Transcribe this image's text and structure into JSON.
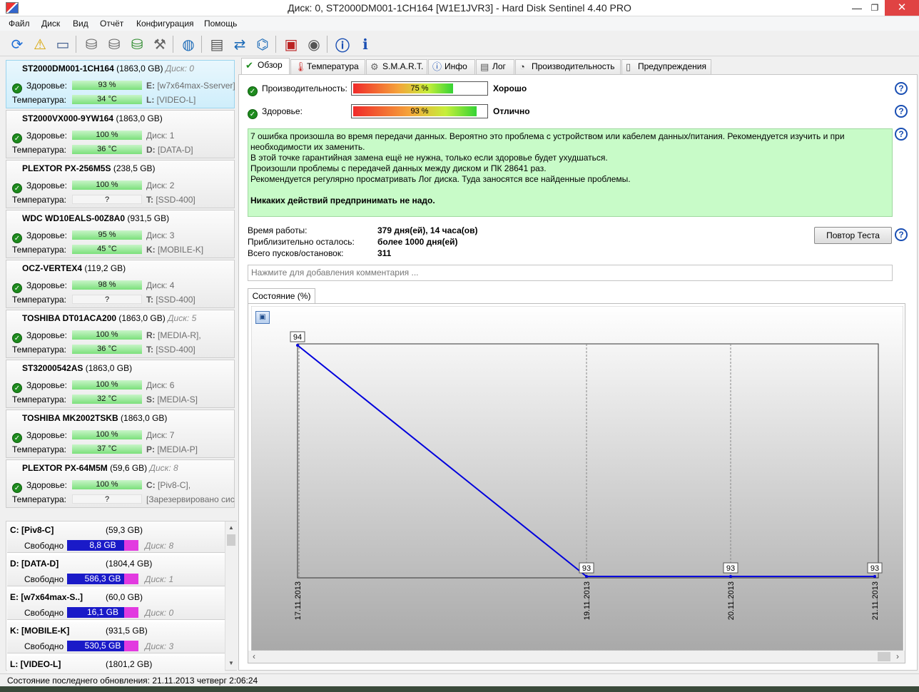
{
  "window": {
    "title": "Диск: 0, ST2000DM001-1CH164 [W1E1JVR3]  -  Hard Disk Sentinel 4.40 PRO",
    "min": "—",
    "max": "❐",
    "close": "✕"
  },
  "menu": [
    "Файл",
    "Диск",
    "Вид",
    "Отчёт",
    "Конфигурация",
    "Помощь"
  ],
  "toolbar_icons": [
    "refresh-icon",
    "alert-icon",
    "disk-icon",
    "surface-test-icon",
    "disk-check-icon",
    "disk-ok-icon",
    "disk-tools-icon",
    "globe-icon",
    "report-icon",
    "transfer-icon",
    "network-icon",
    "settings-icon",
    "sound-icon",
    "help-icon",
    "about-icon"
  ],
  "disks": [
    {
      "name": "ST2000DM001-1CH164",
      "size": "(1863,0 GB)",
      "disk": "Диск: 0",
      "health_label": "Здоровье:",
      "health": "93 %",
      "health_value": 93,
      "temp_label": "Температура:",
      "temp": "34 °C",
      "drive1_letter": "E:",
      "drive1": "[w7x64max-Sserver],",
      "drive2_letter": "L:",
      "drive2": "[VIDEO-L]",
      "selected": true
    },
    {
      "name": "ST2000VX000-9YW164",
      "size": "(1863,0 GB)",
      "disk": "",
      "health_label": "Здоровье:",
      "health": "100 %",
      "health_value": 100,
      "temp_label": "Температура:",
      "temp": "36 °C",
      "drive1_letter": "",
      "drive1": "Диск: 1",
      "drive2_letter": "D:",
      "drive2": "[DATA-D]"
    },
    {
      "name": "PLEXTOR PX-256M5S",
      "size": "(238,5 GB)",
      "disk": "",
      "health_label": "Здоровье:",
      "health": "100 %",
      "health_value": 100,
      "temp_label": "Температура:",
      "temp": "?",
      "drive1_letter": "",
      "drive1": "Диск: 2",
      "drive2_letter": "T:",
      "drive2": "[SSD-400]"
    },
    {
      "name": "WDC WD10EALS-00Z8A0",
      "size": "(931,5 GB)",
      "disk": "",
      "health_label": "Здоровье:",
      "health": "95 %",
      "health_value": 95,
      "temp_label": "Температура:",
      "temp": "45 °C",
      "drive1_letter": "",
      "drive1": "Диск: 3",
      "drive2_letter": "K:",
      "drive2": "[MOBILE-K]"
    },
    {
      "name": "OCZ-VERTEX4",
      "size": "(119,2 GB)",
      "disk": "",
      "health_label": "Здоровье:",
      "health": "98 %",
      "health_value": 98,
      "temp_label": "Температура:",
      "temp": "?",
      "drive1_letter": "",
      "drive1": "Диск: 4",
      "drive2_letter": "T:",
      "drive2": "[SSD-400]"
    },
    {
      "name": "TOSHIBA DT01ACA200",
      "size": "(1863,0 GB)",
      "disk": "Диск: 5",
      "health_label": "Здоровье:",
      "health": "100 %",
      "health_value": 100,
      "temp_label": "Температура:",
      "temp": "36 °C",
      "drive1_letter": "R:",
      "drive1": "[MEDIA-R],",
      "drive2_letter": "T:",
      "drive2": "[SSD-400]"
    },
    {
      "name": "ST32000542AS",
      "size": "(1863,0 GB)",
      "disk": "",
      "health_label": "Здоровье:",
      "health": "100 %",
      "health_value": 100,
      "temp_label": "Температура:",
      "temp": "32 °C",
      "drive1_letter": "",
      "drive1": "Диск: 6",
      "drive2_letter": "S:",
      "drive2": "[MEDIA-S]"
    },
    {
      "name": "TOSHIBA MK2002TSKB",
      "size": "(1863,0 GB)",
      "disk": "",
      "health_label": "Здоровье:",
      "health": "100 %",
      "health_value": 100,
      "temp_label": "Температура:",
      "temp": "37 °C",
      "drive1_letter": "",
      "drive1": "Диск: 7",
      "drive2_letter": "P:",
      "drive2": "[MEDIA-P]"
    },
    {
      "name": "PLEXTOR PX-64M5M",
      "size": "(59,6 GB)",
      "disk": "Диск: 8",
      "health_label": "Здоровье:",
      "health": "100 %",
      "health_value": 100,
      "temp_label": "Температура:",
      "temp": "?",
      "drive1_letter": "C:",
      "drive1": "[Piv8-C],",
      "drive2_letter": "",
      "drive2": "[Зарезервировано сис"
    }
  ],
  "partitions": [
    {
      "name": "C: [Piv8-C]",
      "size": "(59,3 GB)",
      "free_label": "Свободно",
      "free": "8,8 GB",
      "disk": "Диск: 8"
    },
    {
      "name": "D: [DATA-D]",
      "size": "(1804,4 GB)",
      "free_label": "Свободно",
      "free": "586,3 GB",
      "disk": "Диск: 1"
    },
    {
      "name": "E: [w7x64max-S..]",
      "size": "(60,0 GB)",
      "free_label": "Свободно",
      "free": "16,1 GB",
      "disk": "Диск: 0"
    },
    {
      "name": "K: [MOBILE-K]",
      "size": "(931,5 GB)",
      "free_label": "Свободно",
      "free": "530,5 GB",
      "disk": "Диск: 3"
    },
    {
      "name": "L: [VIDEO-L]",
      "size": "(1801,2 GB)",
      "free_label": "",
      "free": "",
      "disk": ""
    }
  ],
  "status": {
    "text": "Состояние последнего обновления: 21.11.2013 четверг 2:06:24"
  },
  "tabs": [
    {
      "label": "Обзор",
      "icon": "check-icon",
      "active": true
    },
    {
      "label": "Температура",
      "icon": "thermometer-icon"
    },
    {
      "label": "S.M.A.R.T.",
      "icon": "smart-icon"
    },
    {
      "label": "Инфо",
      "icon": "info-icon"
    },
    {
      "label": "Лог",
      "icon": "log-icon"
    },
    {
      "label": "Производительность",
      "icon": "performance-icon"
    },
    {
      "label": "Предупреждения",
      "icon": "warnings-icon"
    }
  ],
  "overview": {
    "performance_label": "Производительность:",
    "performance_pct": "75 %",
    "performance_value": 75,
    "performance_verdict": "Хорошо",
    "health_label": "Здоровье:",
    "health_pct": "93 %",
    "health_value": 93,
    "health_verdict": "Отлично",
    "message_lines": [
      "7 ошибка произошла во время передачи данных. Вероятно это проблема с устройством или кабелем данных/питания. Рекомендуется изучить и при",
      "необходимости их заменить.",
      "В этой точке гарантийная замена ещё не нужна, только если здоровье будет ухудшаться.",
      "Произошли проблемы с передачей данных между диском и ПК 28641 раз.",
      "Рекомендуется регулярно просматривать Лог диска. Туда заносятся все найденные проблемы."
    ],
    "message_bold": "Никаких действий предпринимать не надо.",
    "uptime_label": "Время работы:",
    "uptime": "379 дня(ей), 14 часа(ов)",
    "remaining_label": "Приблизительно осталось:",
    "remaining": "более 1000 дня(ей)",
    "starts_label": "Всего пусков/остановок:",
    "starts": "311",
    "retest_button": "Повтор Теста",
    "comment_placeholder": "Нажмите для добавления комментария ...",
    "state_tab": "Состояние (%)",
    "help_glyph": "?"
  },
  "chart_data": {
    "type": "line",
    "x": [
      "17.11.2013",
      "19.11.2013",
      "20.11.2013",
      "21.11.2013"
    ],
    "values": [
      94,
      93,
      93,
      93
    ],
    "point_labels": [
      "94",
      "93",
      "93",
      "93"
    ],
    "ylim": [
      93,
      94
    ],
    "grid": true,
    "line_color": "#0000dd",
    "background": "gradient white-to-gray"
  }
}
